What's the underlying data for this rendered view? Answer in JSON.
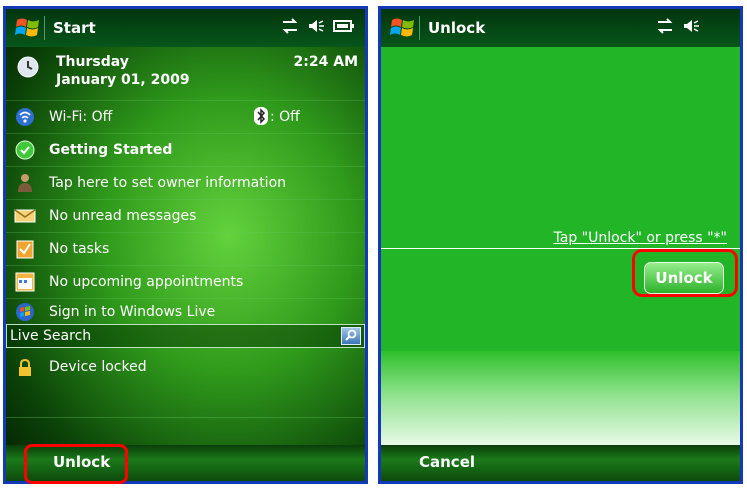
{
  "left": {
    "title": "Start",
    "day": "Thursday",
    "date": "January 01, 2009",
    "time": "2:24 AM",
    "wifi": "Wi-Fi: Off",
    "bluetooth": ": Off",
    "items": [
      {
        "label": "Getting Started"
      },
      {
        "label": "Tap here to set owner information"
      },
      {
        "label": "No unread messages"
      },
      {
        "label": "No tasks"
      },
      {
        "label": "No upcoming appointments"
      },
      {
        "label": "Sign in to Windows Live"
      }
    ],
    "search_label": "Live Search",
    "device_locked": "Device locked",
    "softkey_left": "Unlock"
  },
  "right": {
    "title": "Unlock",
    "hint": "Tap \"Unlock\" or press \"*\"",
    "unlock_button": "Unlock",
    "softkey_left": "Cancel"
  },
  "colors": {
    "highlight": "#ff0000",
    "frame": "#1338b8"
  }
}
